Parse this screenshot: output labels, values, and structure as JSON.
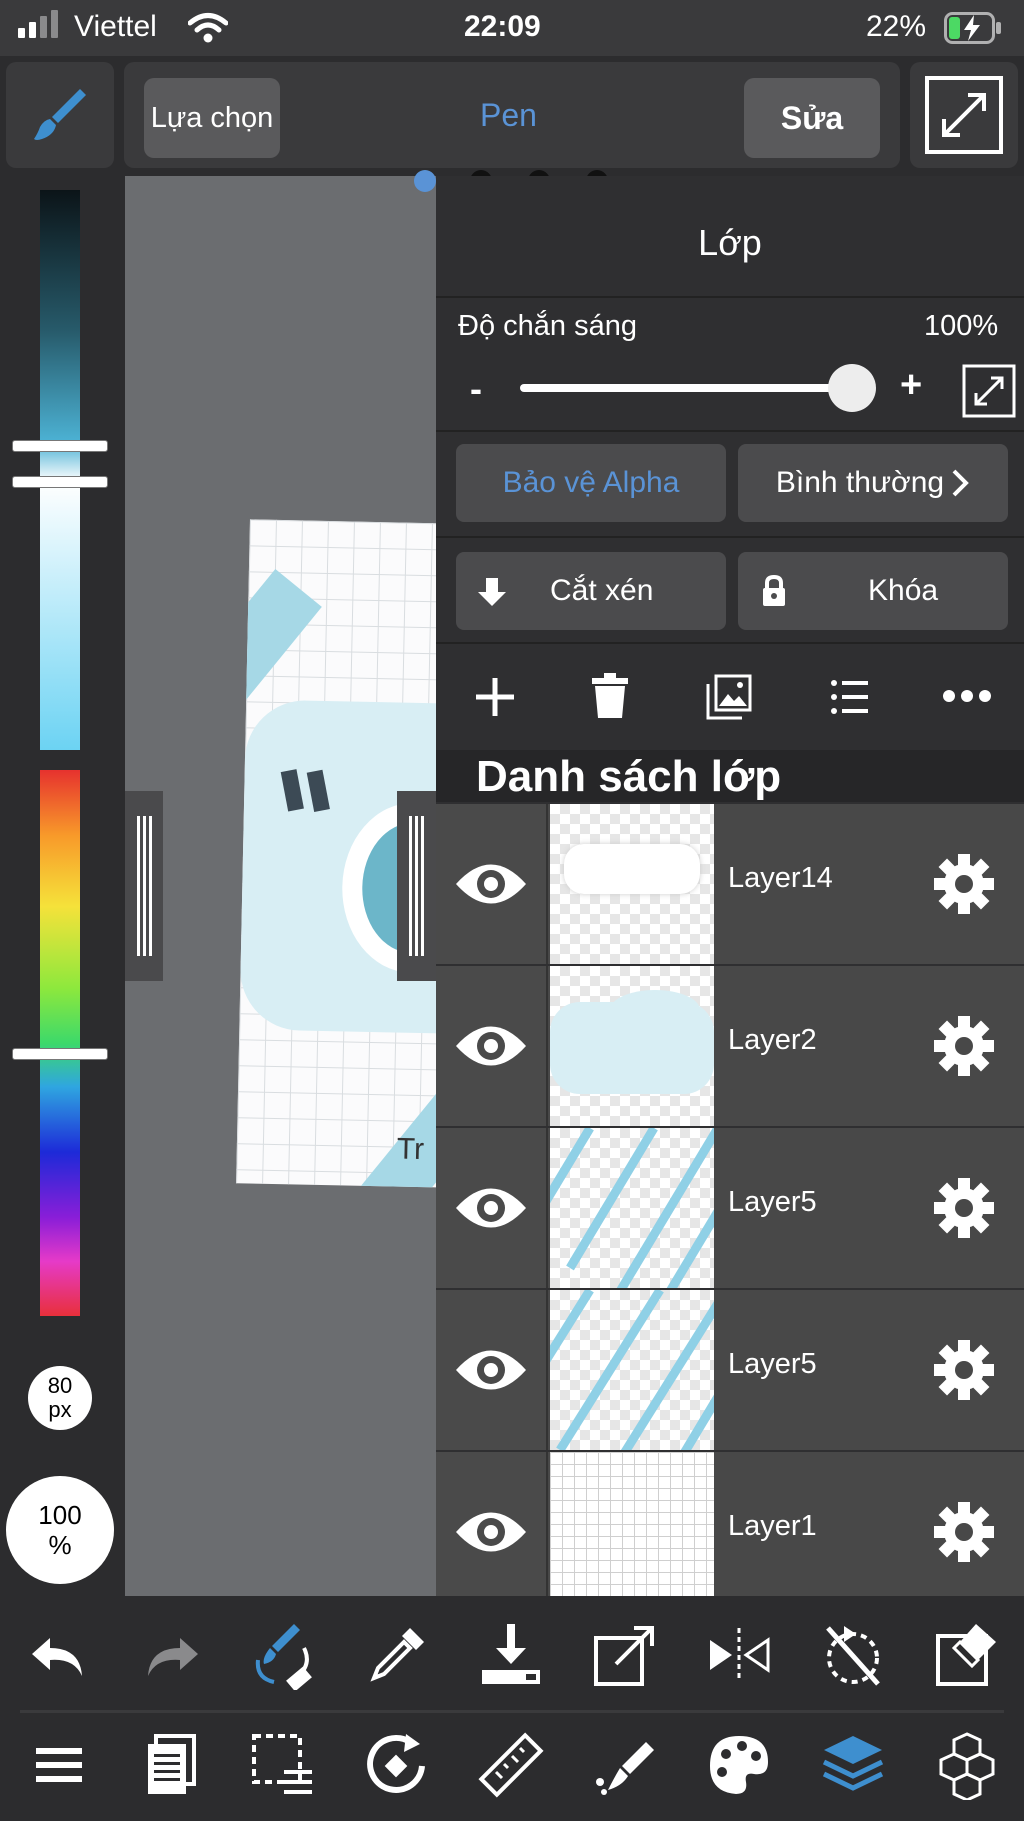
{
  "status": {
    "carrier": "Viettel",
    "time": "22:09",
    "battery": "22%"
  },
  "toolbar": {
    "select_label": "Lựa chọn",
    "tool_label": "Pen",
    "edit_label": "Sửa"
  },
  "brush": {
    "size_value": "80",
    "size_unit": "px",
    "opacity_value": "100",
    "opacity_unit": "%"
  },
  "panel": {
    "title": "Lớp",
    "opacity_label": "Độ chắn sáng",
    "opacity_value": "100%",
    "opacity_level": 1.0,
    "minus": "-",
    "plus": "+",
    "alpha_protect": "Bảo vệ Alpha",
    "blend_mode": "Bình thường",
    "clip": "Cắt xén",
    "lock": "Khóa",
    "list_heading": "Danh sách lớp",
    "layers": [
      {
        "name": "Layer14"
      },
      {
        "name": "Layer2"
      },
      {
        "name": "Layer5"
      },
      {
        "name": "Layer5"
      },
      {
        "name": "Layer1"
      }
    ]
  },
  "canvas": {
    "partial_text": "Tr"
  },
  "colors": {
    "accent_blue": "#5a93d6",
    "panel_bg": "#2f2f31",
    "button_bg": "#4b4b4d"
  }
}
